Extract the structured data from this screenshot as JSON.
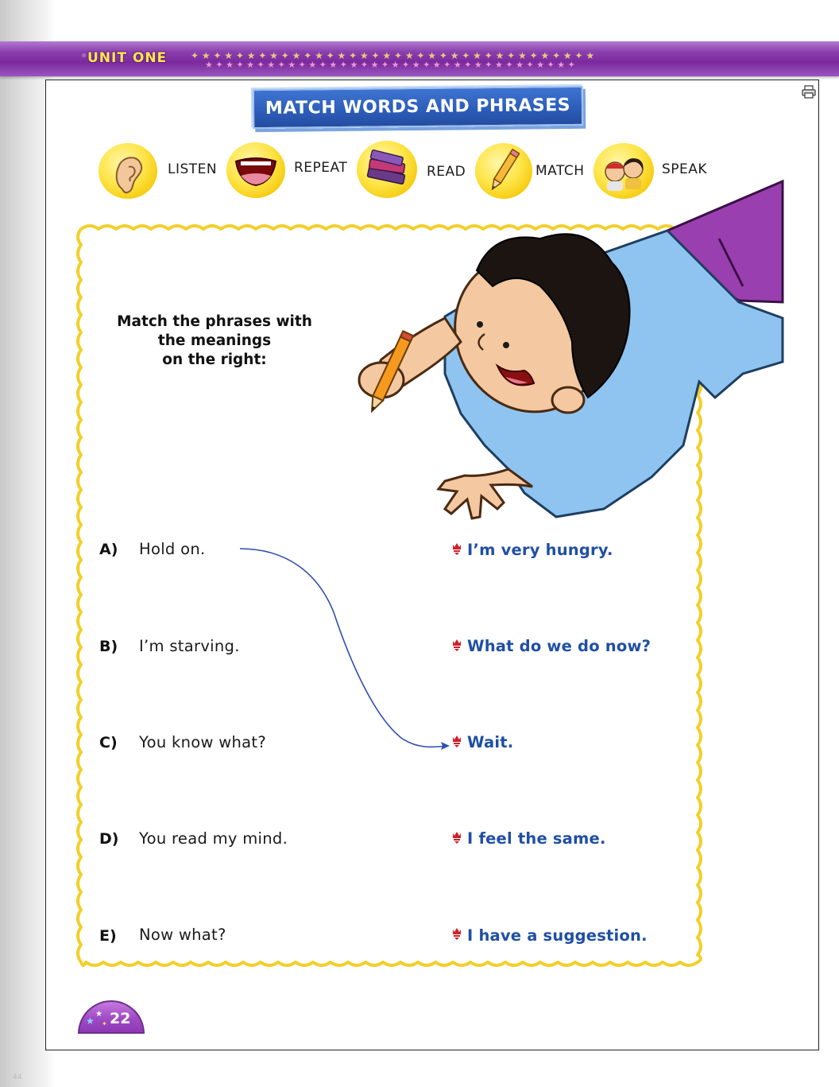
{
  "header": {
    "unit_label": "UNIT ONE"
  },
  "title": "MATCH WORDS AND PHRASES",
  "skills": [
    {
      "label": "LISTEN",
      "icon": "ear-icon"
    },
    {
      "label": "REPEAT",
      "icon": "mouth-icon"
    },
    {
      "label": "READ",
      "icon": "books-icon"
    },
    {
      "label": "MATCH",
      "icon": "pencil-icon"
    },
    {
      "label": "SPEAK",
      "icon": "kids-icon"
    }
  ],
  "instructions": [
    "Match the phrases with",
    "the meanings",
    "on the right:"
  ],
  "rows": [
    {
      "letter": "A)",
      "phrase": "Hold on.",
      "meaning": "I’m very hungry."
    },
    {
      "letter": "B)",
      "phrase": "I’m starving.",
      "meaning": "What do we do now?"
    },
    {
      "letter": "C)",
      "phrase": "You know what?",
      "meaning": "Wait."
    },
    {
      "letter": "D)",
      "phrase": "You read my mind.",
      "meaning": "I feel the same."
    },
    {
      "letter": "E)",
      "phrase": "Now what?",
      "meaning": "I have a suggestion."
    }
  ],
  "page_number": "22",
  "corner_mark": "44",
  "colors": {
    "banner": "#8b3fae",
    "title_badge": "#2c5cb8",
    "meaning_text": "#1f4fa5",
    "wavy_border": "#f2cf2a",
    "match_line": "#2f4fb0",
    "bullet": "#d0202a"
  }
}
